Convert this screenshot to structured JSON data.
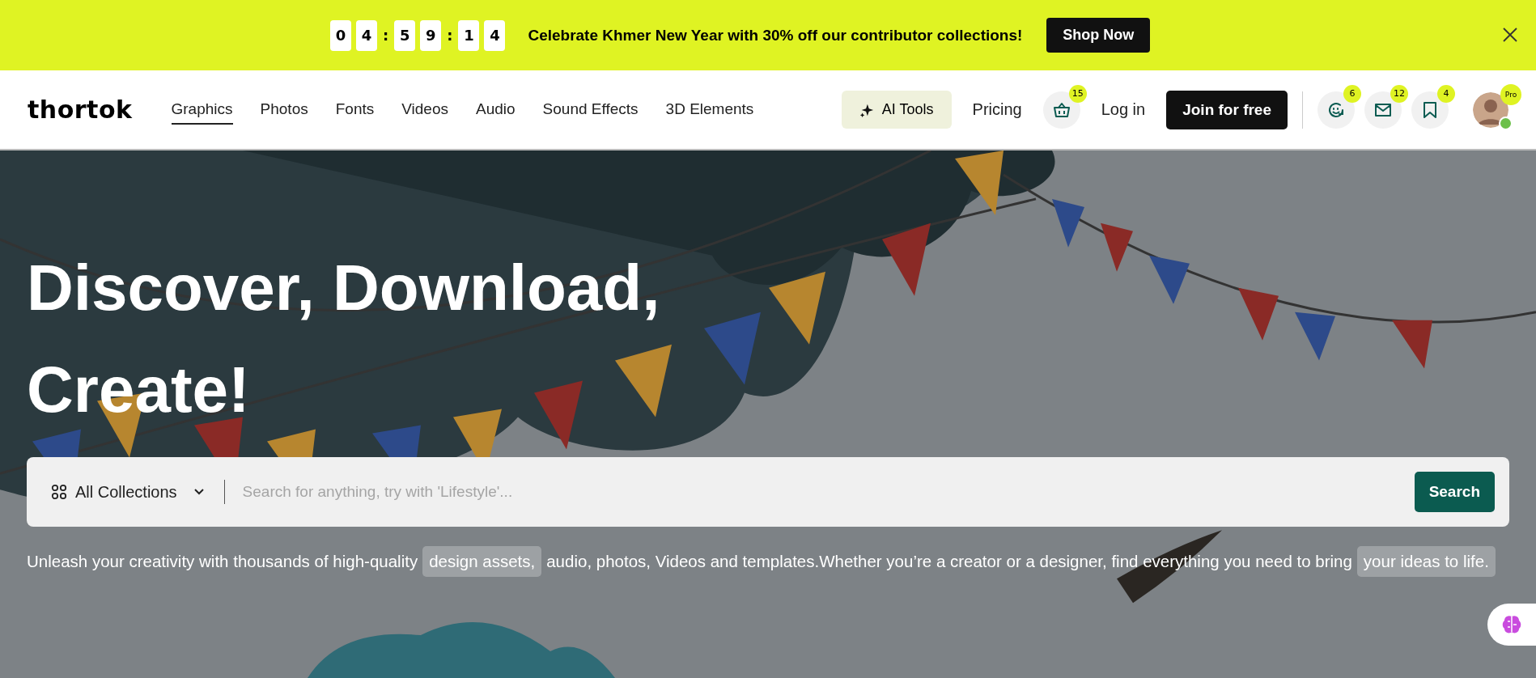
{
  "promo_banner": {
    "countdown": [
      {
        "kind": "digit",
        "text": "0"
      },
      {
        "kind": "digit",
        "text": "4"
      },
      {
        "kind": "separator",
        "text": ":"
      },
      {
        "kind": "digit",
        "text": "5"
      },
      {
        "kind": "digit",
        "text": "9"
      },
      {
        "kind": "separator",
        "text": ":"
      },
      {
        "kind": "digit",
        "text": "1"
      },
      {
        "kind": "digit",
        "text": "4"
      }
    ],
    "message": "Celebrate Khmer New Year with 30% off our contributor collections!",
    "button": "Shop Now"
  },
  "nav": {
    "logo": "thortok",
    "links": [
      {
        "label": "Graphics",
        "selected": true
      },
      {
        "label": "Photos",
        "selected": false
      },
      {
        "label": "Fonts",
        "selected": false
      },
      {
        "label": "Videos",
        "selected": false
      },
      {
        "label": "Audio",
        "selected": false
      },
      {
        "label": "Sound Effects",
        "selected": false
      },
      {
        "label": "3D Elements",
        "selected": false
      }
    ],
    "ai_tools": "AI Tools",
    "pricing": "Pricing",
    "cart_count": "15",
    "login": "Log in",
    "join": "Join for free",
    "icons": [
      {
        "kind": "support",
        "count": "6"
      },
      {
        "kind": "mail",
        "count": "12"
      },
      {
        "kind": "bookmark",
        "count": "4"
      }
    ],
    "avatar": {
      "badge": "Pro",
      "online": true
    }
  },
  "hero": {
    "title_lines": [
      "Discover, Download,",
      "Create!"
    ],
    "search": {
      "collection": "All Collections",
      "placeholder": "Search for anything, try with 'Lifestyle'...",
      "button": "Search"
    },
    "description": [
      {
        "text": "Unleash your creativity with thousands of high-quality",
        "highlighted": false
      },
      {
        "text": "design assets,",
        "highlighted": true
      },
      {
        "text": "audio, photos, Videos and templates.Whether you’re a creator or a designer, find everything you need to bring",
        "highlighted": false
      },
      {
        "text": "your ideas to life.",
        "highlighted": true
      }
    ]
  }
}
